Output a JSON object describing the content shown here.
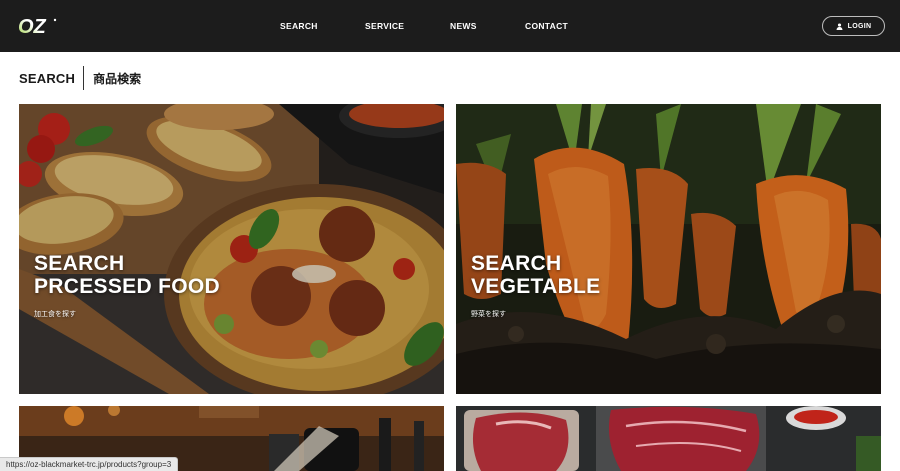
{
  "header": {
    "logo_text": "OZ",
    "nav": [
      "SEARCH",
      "SERVICE",
      "NEWS",
      "CONTACT"
    ],
    "login_label": "LOGIN"
  },
  "section": {
    "title_en": "SEARCH",
    "title_ja": "商品検索"
  },
  "cards": [
    {
      "title": "SEARCH\nPRCESSED FOOD",
      "subtitle": "加工食を探す"
    },
    {
      "title": "SEARCH\nVEGETABLE",
      "subtitle": "野菜を探す"
    },
    {
      "title": "",
      "subtitle": ""
    },
    {
      "title": "",
      "subtitle": ""
    }
  ],
  "status_bar": {
    "url": "https://oz-blackmarket-trc.jp/products?group=3"
  },
  "colors": {
    "header_bg": "#1c1c1c",
    "logo_accent": "#9bd23c",
    "text_dark": "#1a1a1a"
  },
  "icons": {
    "login": "user-icon"
  }
}
